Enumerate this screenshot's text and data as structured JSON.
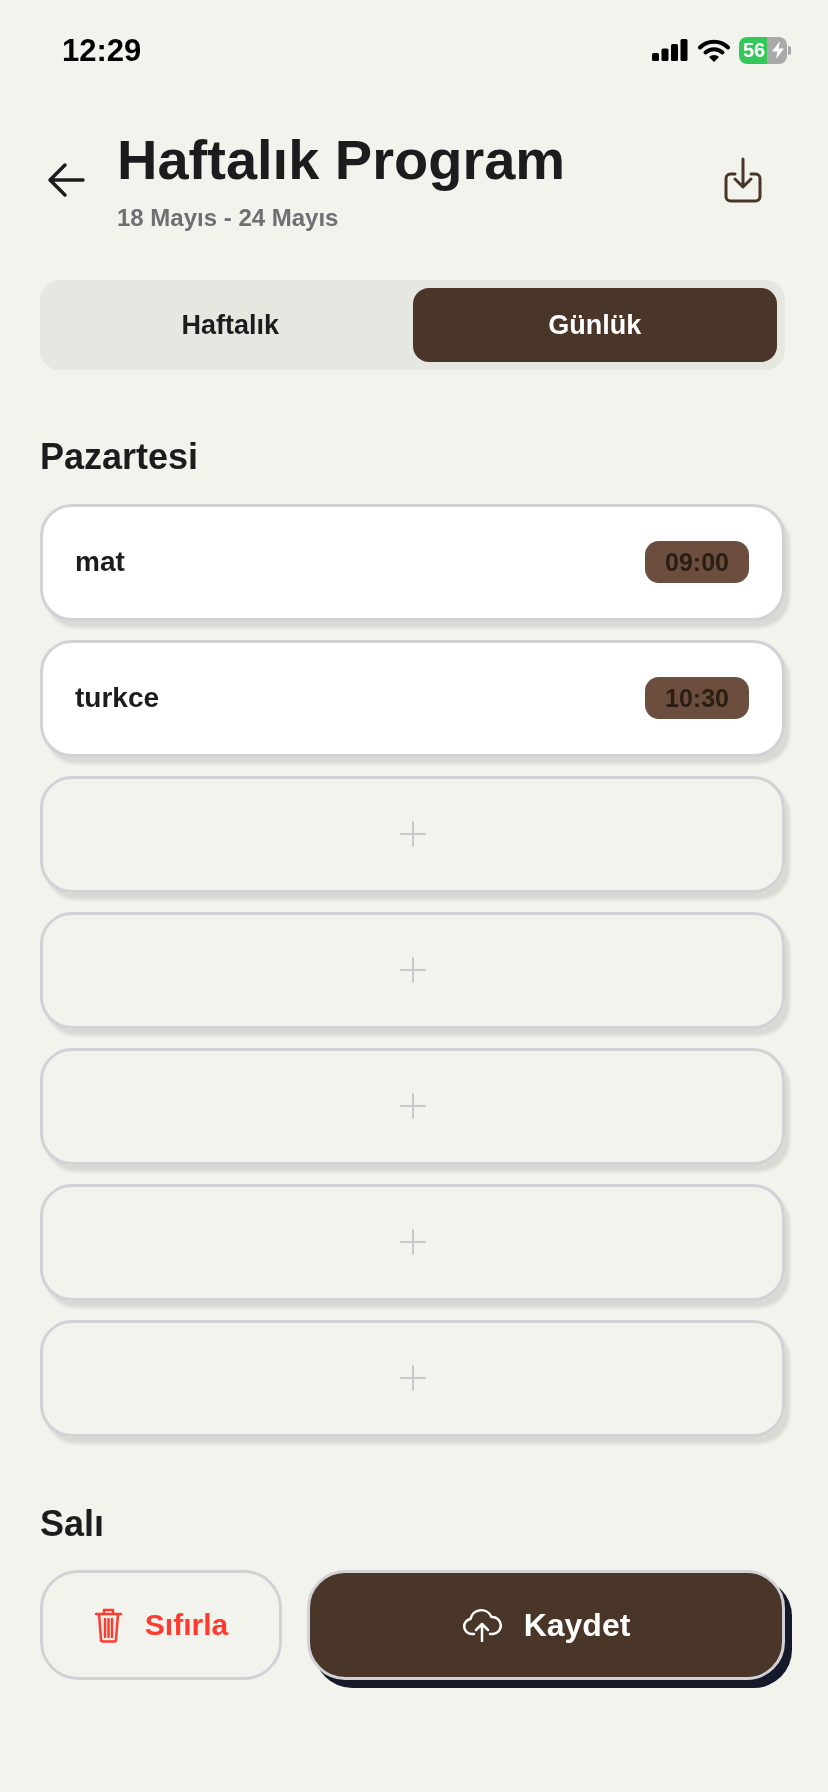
{
  "status_bar": {
    "time": "12:29",
    "battery": "56"
  },
  "header": {
    "title": "Haftalık Program",
    "subtitle": "18 Mayıs - 24 Mayıs"
  },
  "tabs": [
    {
      "label": "Haftalık",
      "selected": false
    },
    {
      "label": "Günlük",
      "selected": true
    }
  ],
  "days": [
    {
      "name": "Pazartesi",
      "slots": [
        {
          "kind": "lesson",
          "title": "mat",
          "time": "09:00"
        },
        {
          "kind": "lesson",
          "title": "turkce",
          "time": "10:30"
        },
        {
          "kind": "empty"
        },
        {
          "kind": "empty"
        },
        {
          "kind": "empty"
        },
        {
          "kind": "empty"
        },
        {
          "kind": "empty"
        }
      ]
    },
    {
      "name": "Salı"
    }
  ],
  "actions": [
    {
      "kind": "reset",
      "label": "Sıfırla"
    },
    {
      "kind": "save",
      "label": "Kaydet"
    }
  ]
}
